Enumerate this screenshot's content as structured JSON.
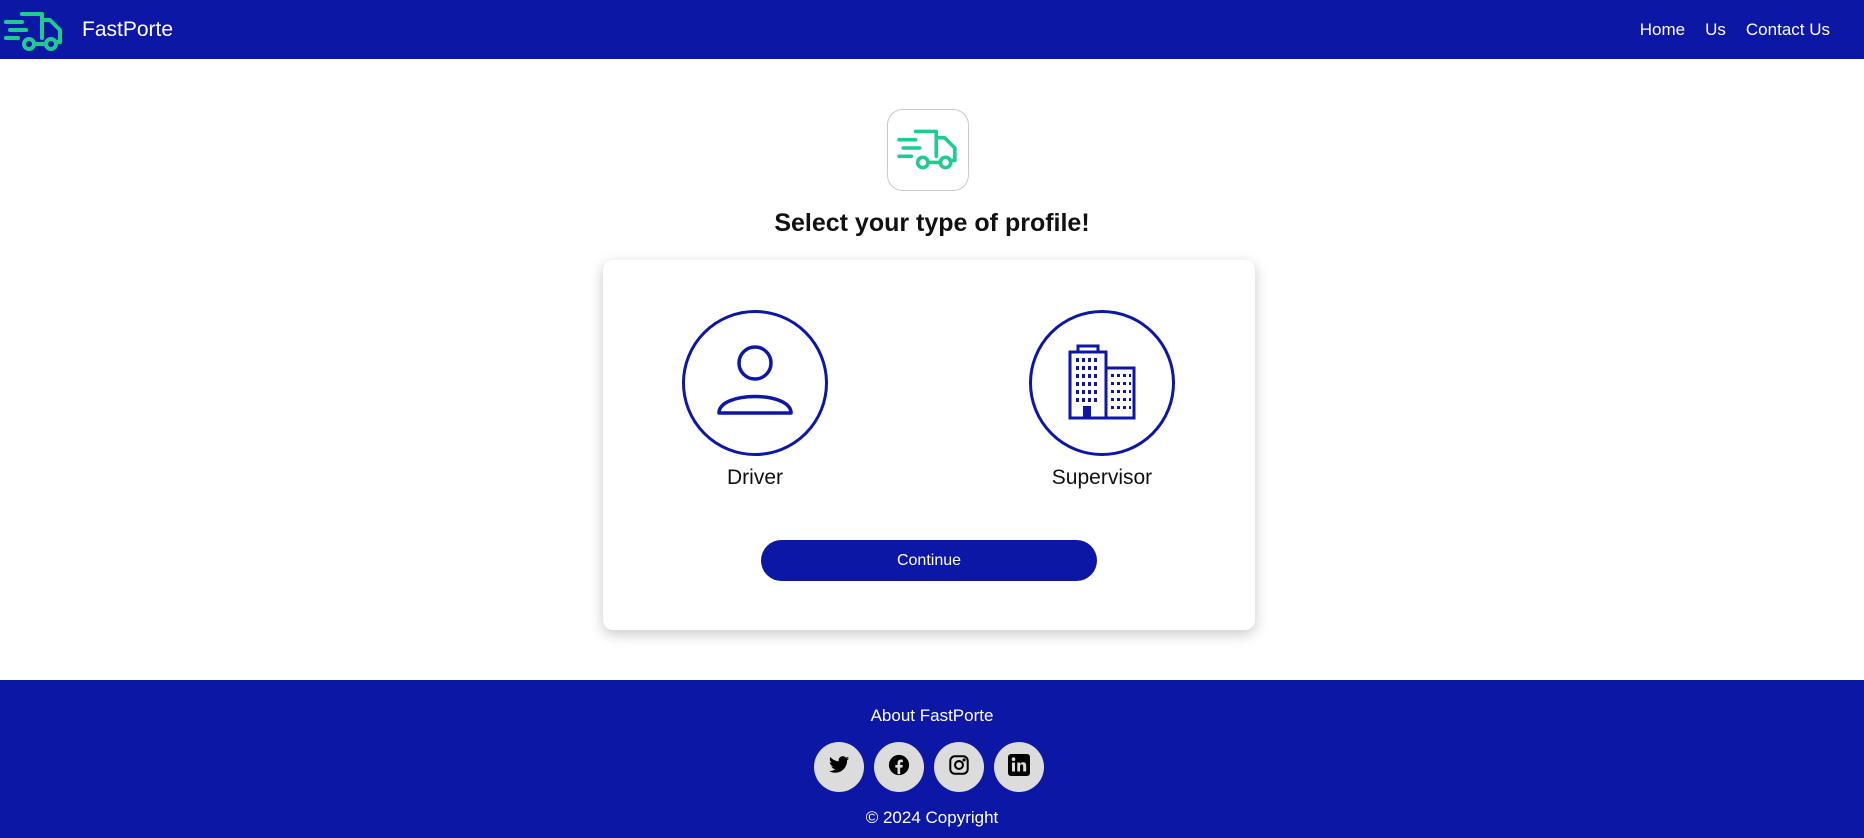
{
  "header": {
    "brand_name": "FastPorte",
    "logo_icon": "delivery-truck-icon",
    "nav": [
      "Home",
      "Us",
      "Contact Us"
    ]
  },
  "main": {
    "app_icon": "delivery-truck-icon",
    "title": "Select your type of profile!",
    "options": [
      {
        "label": "Driver",
        "icon": "person-icon"
      },
      {
        "label": "Supervisor",
        "icon": "buildings-icon"
      }
    ],
    "continue_label": "Continue"
  },
  "footer": {
    "about": "About FastPorte",
    "socials": [
      "twitter-icon",
      "facebook-icon",
      "instagram-icon",
      "linkedin-icon"
    ],
    "copyright": "© 2024 Copyright"
  },
  "colors": {
    "primary": "#0d17a6",
    "accent": "#1fcc8f",
    "social_bg": "#dcdcdc"
  }
}
